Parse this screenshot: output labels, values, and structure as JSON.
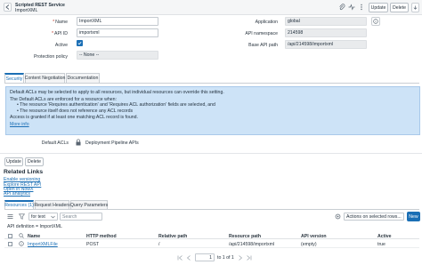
{
  "header": {
    "subtitle": "Scripted REST Service",
    "record_name": "ImportXML",
    "update_label": "Update",
    "delete_label": "Delete"
  },
  "form": {
    "name_label": "Name",
    "name_value": "ImportXML",
    "api_id_label": "API ID",
    "api_id_value": "importxml",
    "active_label": "Active",
    "protection_label": "Protection policy",
    "protection_value": "-- None --",
    "application_label": "Application",
    "application_value": "global",
    "api_namespace_label": "API namespace",
    "api_namespace_value": "214598",
    "base_api_path_label": "Base API path",
    "base_api_path_value": "/api/214598/importxml"
  },
  "tabs": [
    {
      "label": "Security"
    },
    {
      "label": "Content Negotiation"
    },
    {
      "label": "Documentation"
    }
  ],
  "info_box": {
    "line1": "Default ACLs may be selected to apply to all resources, but individual resources can override this setting.",
    "line2": "The Default ACLs are enforced for a resource when:",
    "bullet1": "The resource 'Requires authentication' and 'Requires ACL authorization' fields are selected, and",
    "bullet2": "The resource itself does not reference any ACL records",
    "line3": "Access is granted if at least one matching ACL record is found.",
    "more_info": "More info"
  },
  "default_acls": {
    "label": "Default ACLs",
    "value": "Deployment Pipeline APIs"
  },
  "bottom_buttons": {
    "update_label": "Update",
    "delete_label": "Delete"
  },
  "related_links": {
    "title": "Related Links",
    "links": [
      "Enable versioning",
      "Explore REST API",
      "Open in NowX",
      "API analytics"
    ]
  },
  "related_tabs": [
    {
      "label": "Resources (1)"
    },
    {
      "label": "Request Headers"
    },
    {
      "label": "Query Parameters"
    }
  ],
  "list_toolbar": {
    "search_field_value": "for text",
    "search_placeholder": "Search",
    "actions_value": "Actions on selected rows...",
    "new_label": "New"
  },
  "breadcrumb": "API definition = ImportXML",
  "table": {
    "columns": [
      "Name",
      "HTTP method",
      "Relative path",
      "Resource path",
      "API version",
      "Active"
    ],
    "rows": [
      [
        "ImportXMLFile",
        "POST",
        "/",
        "/api/214598/importxml",
        "(empty)",
        "true"
      ]
    ]
  },
  "pagination": {
    "page_value": "1",
    "page_text": "to 1 of 1"
  },
  "colors": {
    "accent": "#1b6fb5",
    "info_bg": "#cde3f7",
    "primary_button": "#1b6fb5"
  }
}
